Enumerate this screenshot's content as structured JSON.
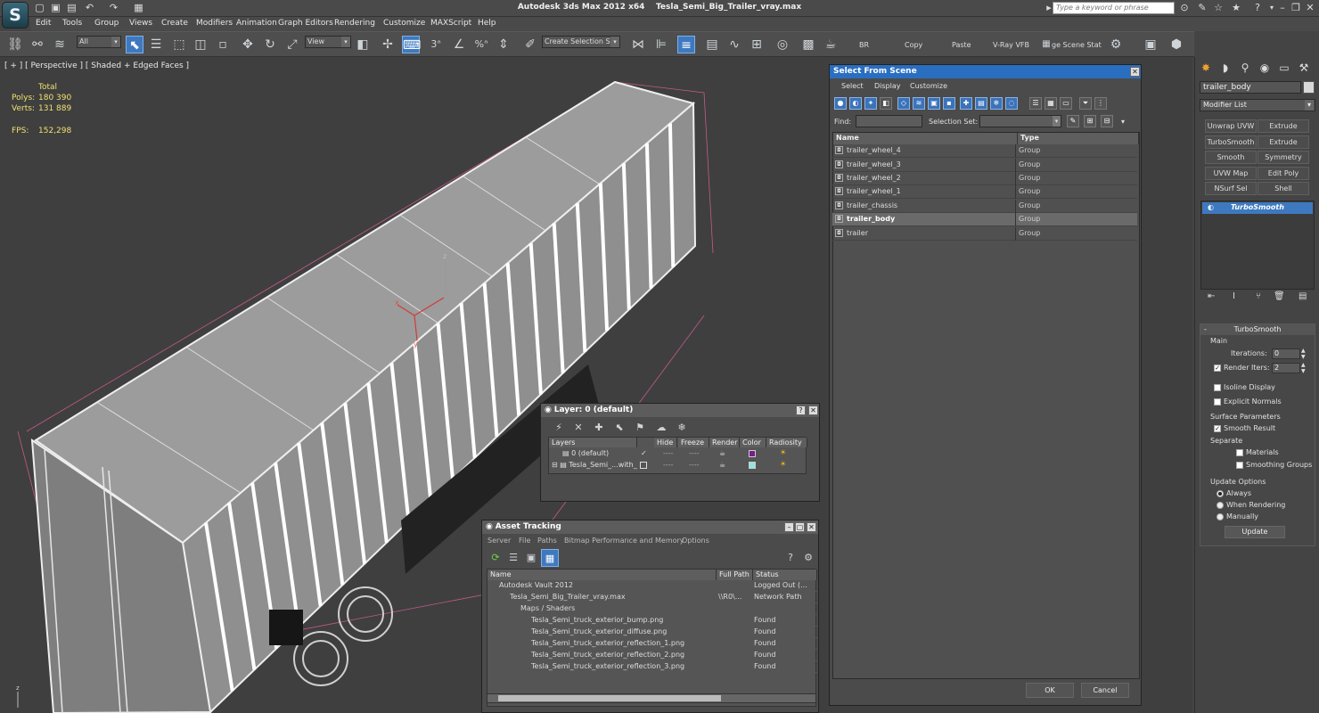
{
  "app": {
    "title": "Autodesk 3ds Max  2012 x64",
    "file": "Tesla_Semi_Big_Trailer_vray.max",
    "search_placeholder": "Type a keyword or phrase"
  },
  "menu": [
    "Edit",
    "Tools",
    "Group",
    "Views",
    "Create",
    "Modifiers",
    "Animation",
    "Graph Editors",
    "Rendering",
    "Customize",
    "MAXScript",
    "Help"
  ],
  "toolbar": {
    "filter": "All",
    "coord": "View",
    "selection_set": "Create Selection Se",
    "snap_label": "3",
    "percent_label": "%",
    "br": "BR",
    "copy": "Copy",
    "paste": "Paste",
    "vray": "V-Ray VFB",
    "scene_state": "ge Scene Stat"
  },
  "viewport": {
    "label": "[ + ] [ Perspective ] [ Shaded + Edged Faces ]",
    "stats": {
      "total": "Total",
      "polys_label": "Polys:",
      "polys": "180 390",
      "verts_label": "Verts:",
      "verts": "131 889",
      "fps_label": "FPS:",
      "fps": "152,298"
    },
    "axis": {
      "x": "x",
      "y": "y",
      "z": "z"
    }
  },
  "cmdpanel": {
    "object_name": "trailer_body",
    "modifier_list": "Modifier List",
    "buttons": [
      "Unwrap UVW",
      "Extrude",
      "TurboSmooth",
      "Extrude",
      "Smooth",
      "Symmetry",
      "UVW Map",
      "Edit Poly",
      "NSurf Sel",
      "Shell"
    ],
    "stack_item": "TurboSmooth",
    "turbosmooth": {
      "title": "TurboSmooth",
      "main": "Main",
      "iterations_label": "Iterations:",
      "iterations": "0",
      "render_iters_label": "Render Iters:",
      "render_iters": "2",
      "isoline": "Isoline Display",
      "explicit": "Explicit Normals",
      "surface_params": "Surface Parameters",
      "smooth_result": "Smooth Result",
      "separate": "Separate",
      "materials": "Materials",
      "smoothing_groups": "Smoothing Groups",
      "update_options": "Update Options",
      "always": "Always",
      "when_rendering": "When Rendering",
      "manually": "Manually",
      "update": "Update"
    }
  },
  "select_from_scene": {
    "title": "Select From Scene",
    "menu": [
      "Select",
      "Display",
      "Customize"
    ],
    "find_label": "Find:",
    "selection_set_label": "Selection Set:",
    "col_name": "Name",
    "col_type": "Type",
    "rows": [
      {
        "name": "trailer_wheel_4",
        "type": "Group"
      },
      {
        "name": "trailer_wheel_3",
        "type": "Group"
      },
      {
        "name": "trailer_wheel_2",
        "type": "Group"
      },
      {
        "name": "trailer_wheel_1",
        "type": "Group"
      },
      {
        "name": "trailer_chassis",
        "type": "Group"
      },
      {
        "name": "trailer_body",
        "type": "Group"
      },
      {
        "name": "trailer",
        "type": "Group"
      }
    ],
    "selected": "trailer_body",
    "ok": "OK",
    "cancel": "Cancel"
  },
  "layer": {
    "title": "Layer: 0 (default)",
    "cols": [
      "Layers",
      "Hide",
      "Freeze",
      "Render",
      "Color",
      "Radiosity"
    ],
    "rows": [
      {
        "name": "0 (default)",
        "check": "✓",
        "color": "#7a1c8c"
      },
      {
        "name": "Tesla_Semi_...with_",
        "check": "",
        "color": "#8ee8e0"
      }
    ]
  },
  "asset": {
    "title": "Asset Tracking",
    "menu": [
      "Server",
      "File",
      "Paths",
      "Bitmap Performance and Memory",
      "Options"
    ],
    "cols": [
      "Name",
      "Full Path",
      "Status"
    ],
    "rows": [
      {
        "indent": 12,
        "name": "Autodesk Vault 2012",
        "path": "",
        "status": "Logged Out (..."
      },
      {
        "indent": 24,
        "name": "Tesla_Semi_Big_Trailer_vray.max",
        "path": "\\\\R0\\...",
        "status": "Network Path"
      },
      {
        "indent": 36,
        "name": "Maps / Shaders",
        "path": "",
        "status": ""
      },
      {
        "indent": 48,
        "name": "Tesla_Semi_truck_exterior_bump.png",
        "path": "",
        "status": "Found"
      },
      {
        "indent": 48,
        "name": "Tesla_Semi_truck_exterior_diffuse.png",
        "path": "",
        "status": "Found"
      },
      {
        "indent": 48,
        "name": "Tesla_Semi_truck_exterior_reflection_1.png",
        "path": "",
        "status": "Found"
      },
      {
        "indent": 48,
        "name": "Tesla_Semi_truck_exterior_reflection_2.png",
        "path": "",
        "status": "Found"
      },
      {
        "indent": 48,
        "name": "Tesla_Semi_truck_exterior_reflection_3.png",
        "path": "",
        "status": "Found"
      }
    ]
  },
  "colors": {
    "accent": "#3e79c0",
    "selected_row": "#6a6a6a",
    "stat_yellow": "#f0e070",
    "dialog_title": "#2a6ec0"
  }
}
